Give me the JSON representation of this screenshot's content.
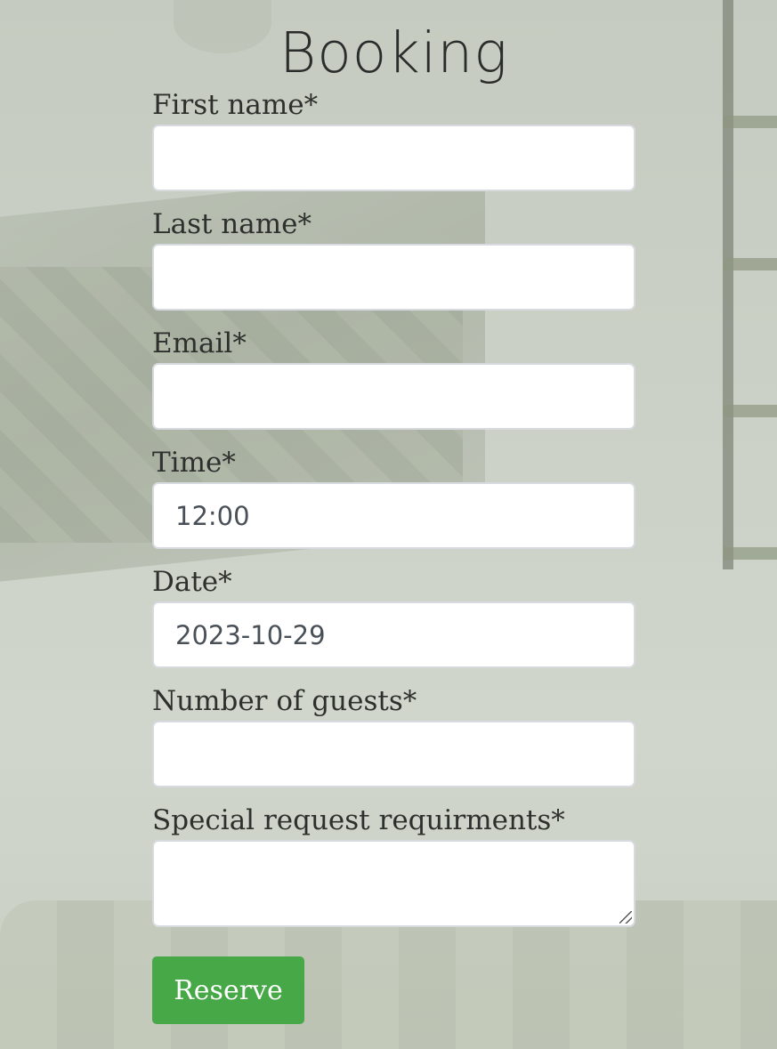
{
  "form": {
    "title": "Booking",
    "fields": [
      {
        "label": "First name*",
        "value": ""
      },
      {
        "label": "Last name*",
        "value": ""
      },
      {
        "label": "Email*",
        "value": ""
      },
      {
        "label": "Time*",
        "value": "12:00"
      },
      {
        "label": "Date*",
        "value": "2023-10-29"
      },
      {
        "label": "Number of guests*",
        "value": ""
      },
      {
        "label": "Special request requirments*",
        "value": ""
      }
    ],
    "submit_label": "Reserve"
  },
  "colors": {
    "primary_button": "#46a846",
    "input_border": "#d7dbe0",
    "text": "#2e302d"
  }
}
